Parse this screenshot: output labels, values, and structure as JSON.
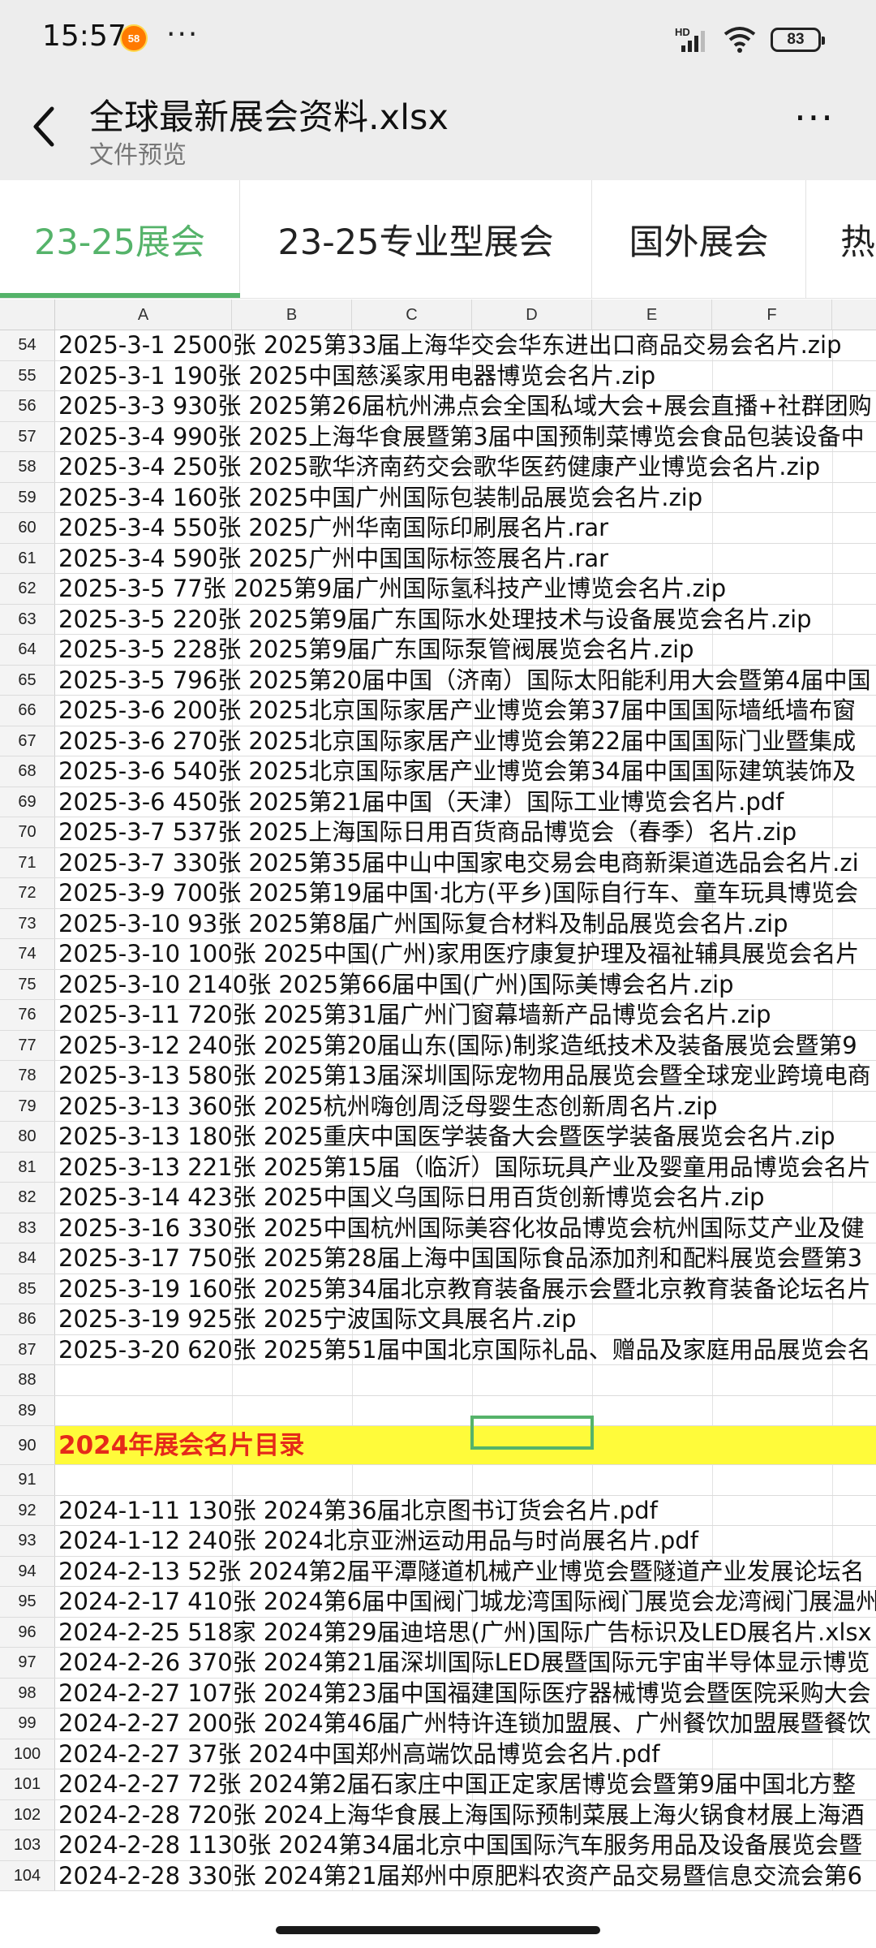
{
  "status": {
    "time": "15:57",
    "app_badge": "58",
    "more": "···",
    "hd": "HD",
    "battery": "83"
  },
  "header": {
    "title": "全球最新展会资料.xlsx",
    "subtitle": "文件预览",
    "more": "···"
  },
  "sheet_tabs": [
    {
      "label": "23-25展会",
      "active": true
    },
    {
      "label": "23-25专业型展会",
      "active": false
    },
    {
      "label": "国外展会",
      "active": false
    },
    {
      "label": "热",
      "active": false
    }
  ],
  "columns": [
    "A",
    "B",
    "C",
    "D",
    "E",
    "F"
  ],
  "rows": [
    {
      "num": "54",
      "text": "2025-3-1 2500张 2025第33届上海华交会华东进出口商品交易会名片.zip"
    },
    {
      "num": "55",
      "text": "2025-3-1 190张 2025中国慈溪家用电器博览会名片.zip"
    },
    {
      "num": "56",
      "text": "2025-3-3 930张 2025第26届杭州沸点会全国私域大会+展会直播+社群团购"
    },
    {
      "num": "57",
      "text": "2025-3-4 990张 2025上海华食展暨第3届中国预制菜博览会食品包装设备中"
    },
    {
      "num": "58",
      "text": "2025-3-4 250张 2025歌华济南药交会歌华医药健康产业博览会名片.zip"
    },
    {
      "num": "59",
      "text": "2025-3-4 160张 2025中国广州国际包装制品展览会名片.zip"
    },
    {
      "num": "60",
      "text": "2025-3-4 550张 2025广州华南国际印刷展名片.rar"
    },
    {
      "num": "61",
      "text": "2025-3-4 590张 2025广州中国国际标签展名片.rar"
    },
    {
      "num": "62",
      "text": "2025-3-5 77张 2025第9届广州国际氢科技产业博览会名片.zip"
    },
    {
      "num": "63",
      "text": "2025-3-5 220张 2025第9届广东国际水处理技术与设备展览会名片.zip"
    },
    {
      "num": "64",
      "text": "2025-3-5 228张 2025第9届广东国际泵管阀展览会名片.zip"
    },
    {
      "num": "65",
      "text": "2025-3-5 796张 2025第20届中国（济南）国际太阳能利用大会暨第4届中国"
    },
    {
      "num": "66",
      "text": "2025-3-6 200张 2025北京国际家居产业博览会第37届中国国际墙纸墙布窗"
    },
    {
      "num": "67",
      "text": "2025-3-6 270张 2025北京国际家居产业博览会第22届中国国际门业暨集成"
    },
    {
      "num": "68",
      "text": "2025-3-6 540张 2025北京国际家居产业博览会第34届中国国际建筑装饰及"
    },
    {
      "num": "69",
      "text": "2025-3-6 450张 2025第21届中国（天津）国际工业博览会名片.pdf"
    },
    {
      "num": "70",
      "text": "2025-3-7 537张 2025上海国际日用百货商品博览会（春季）名片.zip"
    },
    {
      "num": "71",
      "text": "2025-3-7 330张 2025第35届中山中国家电交易会电商新渠道选品会名片.zi"
    },
    {
      "num": "72",
      "text": "2025-3-9 700张 2025第19届中国·北方(平乡)国际自行车、童车玩具博览会"
    },
    {
      "num": "73",
      "text": "2025-3-10 93张 2025第8届广州国际复合材料及制品展览会名片.zip"
    },
    {
      "num": "74",
      "text": "2025-3-10 100张 2025中国(广州)家用医疗康复护理及福祉辅具展览会名片"
    },
    {
      "num": "75",
      "text": "2025-3-10 2140张 2025第66届中国(广州)国际美博会名片.zip"
    },
    {
      "num": "76",
      "text": "2025-3-11 720张 2025第31届广州门窗幕墙新产品博览会名片.zip"
    },
    {
      "num": "77",
      "text": "2025-3-12 240张 2025第20届山东(国际)制浆造纸技术及装备展览会暨第9"
    },
    {
      "num": "78",
      "text": "2025-3-13 580张 2025第13届深圳国际宠物用品展览会暨全球宠业跨境电商"
    },
    {
      "num": "79",
      "text": "2025-3-13 360张 2025杭州嗨创周泛母婴生态创新周名片.zip"
    },
    {
      "num": "80",
      "text": "2025-3-13 180张 2025重庆中国医学装备大会暨医学装备展览会名片.zip"
    },
    {
      "num": "81",
      "text": "2025-3-13 221张 2025第15届（临沂）国际玩具产业及婴童用品博览会名片"
    },
    {
      "num": "82",
      "text": "2025-3-14 423张 2025中国义乌国际日用百货创新博览会名片.zip"
    },
    {
      "num": "83",
      "text": "2025-3-16 330张 2025中国杭州国际美容化妆品博览会杭州国际艾产业及健"
    },
    {
      "num": "84",
      "text": "2025-3-17 750张 2025第28届上海中国国际食品添加剂和配料展览会暨第3"
    },
    {
      "num": "85",
      "text": "2025-3-19 160张 2025第34届北京教育装备展示会暨北京教育装备论坛名片"
    },
    {
      "num": "86",
      "text": "2025-3-19 925张 2025宁波国际文具展名片.zip"
    },
    {
      "num": "87",
      "text": "2025-3-20 620张 2025第51届中国北京国际礼品、赠品及家庭用品展览会名"
    },
    {
      "num": "88",
      "text": ""
    },
    {
      "num": "89",
      "text": ""
    },
    {
      "num": "90",
      "text": "2024年展会名片目录",
      "highlight": true
    },
    {
      "num": "91",
      "text": ""
    },
    {
      "num": "92",
      "text": "2024-1-11 130张 2024第36届北京图书订货会名片.pdf"
    },
    {
      "num": "93",
      "text": "2024-1-12 240张 2024北京亚洲运动用品与时尚展名片.pdf"
    },
    {
      "num": "94",
      "text": "2024-2-13 52张 2024第2届平潭隧道机械产业博览会暨隧道产业发展论坛名"
    },
    {
      "num": "95",
      "text": "2024-2-17 410张 2024第6届中国阀门城龙湾国际阀门展览会龙湾阀门展温州"
    },
    {
      "num": "96",
      "text": "2024-2-25 518家 2024第29届迪培思(广州)国际广告标识及LED展名片.xlsx"
    },
    {
      "num": "97",
      "text": "2024-2-26 370张 2024第21届深圳国际LED展暨国际元宇宙半导体显示博览"
    },
    {
      "num": "98",
      "text": "2024-2-27 107张 2024第23届中国福建国际医疗器械博览会暨医院采购大会"
    },
    {
      "num": "99",
      "text": "2024-2-27 200张 2024第46届广州特许连锁加盟展、广州餐饮加盟展暨餐饮"
    },
    {
      "num": "100",
      "text": "2024-2-27 37张 2024中国郑州高端饮品博览会名片.pdf"
    },
    {
      "num": "101",
      "text": "2024-2-27 72张 2024第2届石家庄中国正定家居博览会暨第9届中国北方整"
    },
    {
      "num": "102",
      "text": "2024-2-28 720张 2024上海华食展上海国际预制菜展上海火锅食材展上海酒"
    },
    {
      "num": "103",
      "text": "2024-2-28 1130张 2024第34届北京中国国际汽车服务用品及设备展览会暨"
    },
    {
      "num": "104",
      "text": "2024-2-28 330张 2024第21届郑州中原肥料农资产品交易暨信息交流会第6"
    }
  ],
  "colors": {
    "accent": "#55b36a",
    "highlight_bg": "#fffb3a",
    "highlight_text": "#e52a1a"
  }
}
